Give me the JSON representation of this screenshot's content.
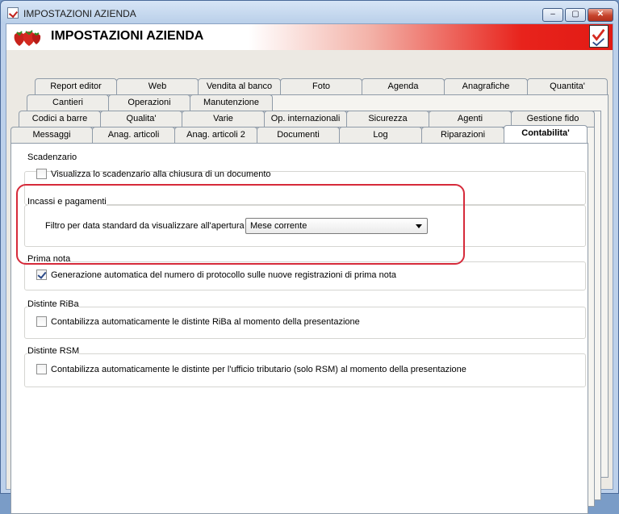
{
  "window": {
    "title": "IMPOSTAZIONI AZIENDA",
    "minimize_label": "–",
    "maximize_label": "▢",
    "close_label": "✕"
  },
  "banner": {
    "title": "IMPOSTAZIONI AZIENDA"
  },
  "tabs": {
    "row1": [
      "Report editor",
      "Web",
      "Vendita al banco",
      "Foto",
      "Agenda",
      "Anagrafiche",
      "Quantita'"
    ],
    "row2": [
      "Cantieri",
      "Operazioni",
      "Manutenzione"
    ],
    "row3": [
      "Codici a barre",
      "Qualita'",
      "Varie",
      "Op. internazionali",
      "Sicurezza",
      "Agenti",
      "Gestione fido"
    ],
    "row4": [
      "Messaggi",
      "Anag. articoli",
      "Anag. articoli 2",
      "Documenti",
      "Log",
      "Riparazioni",
      "Contabilita'"
    ],
    "active": "Contabilita'"
  },
  "groups": {
    "scadenzario": {
      "title": "Scadenzario",
      "checkbox_label": "Visualizza lo scadenzario alla chiusura di un documento",
      "checked": false
    },
    "incassi": {
      "title": "Incassi e pagamenti",
      "filter_label": "Filtro per data standard da visualizzare all'apertura :",
      "filter_value": "Mese corrente"
    },
    "prima_nota": {
      "title": "Prima nota",
      "checkbox_label": "Generazione automatica del numero di protocollo sulle nuove registrazioni di prima nota",
      "checked": true
    },
    "riba": {
      "title": "Distinte RiBa",
      "checkbox_label": "Contabilizza automaticamente le distinte RiBa al momento della presentazione",
      "checked": false
    },
    "rsm": {
      "title": "Distinte RSM",
      "checkbox_label": "Contabilizza automaticamente le distinte per l'ufficio tributario (solo RSM) al momento della presentazione",
      "checked": false
    }
  },
  "colors": {
    "highlight": "#d62a3a",
    "banner_red": "#e11a14"
  }
}
